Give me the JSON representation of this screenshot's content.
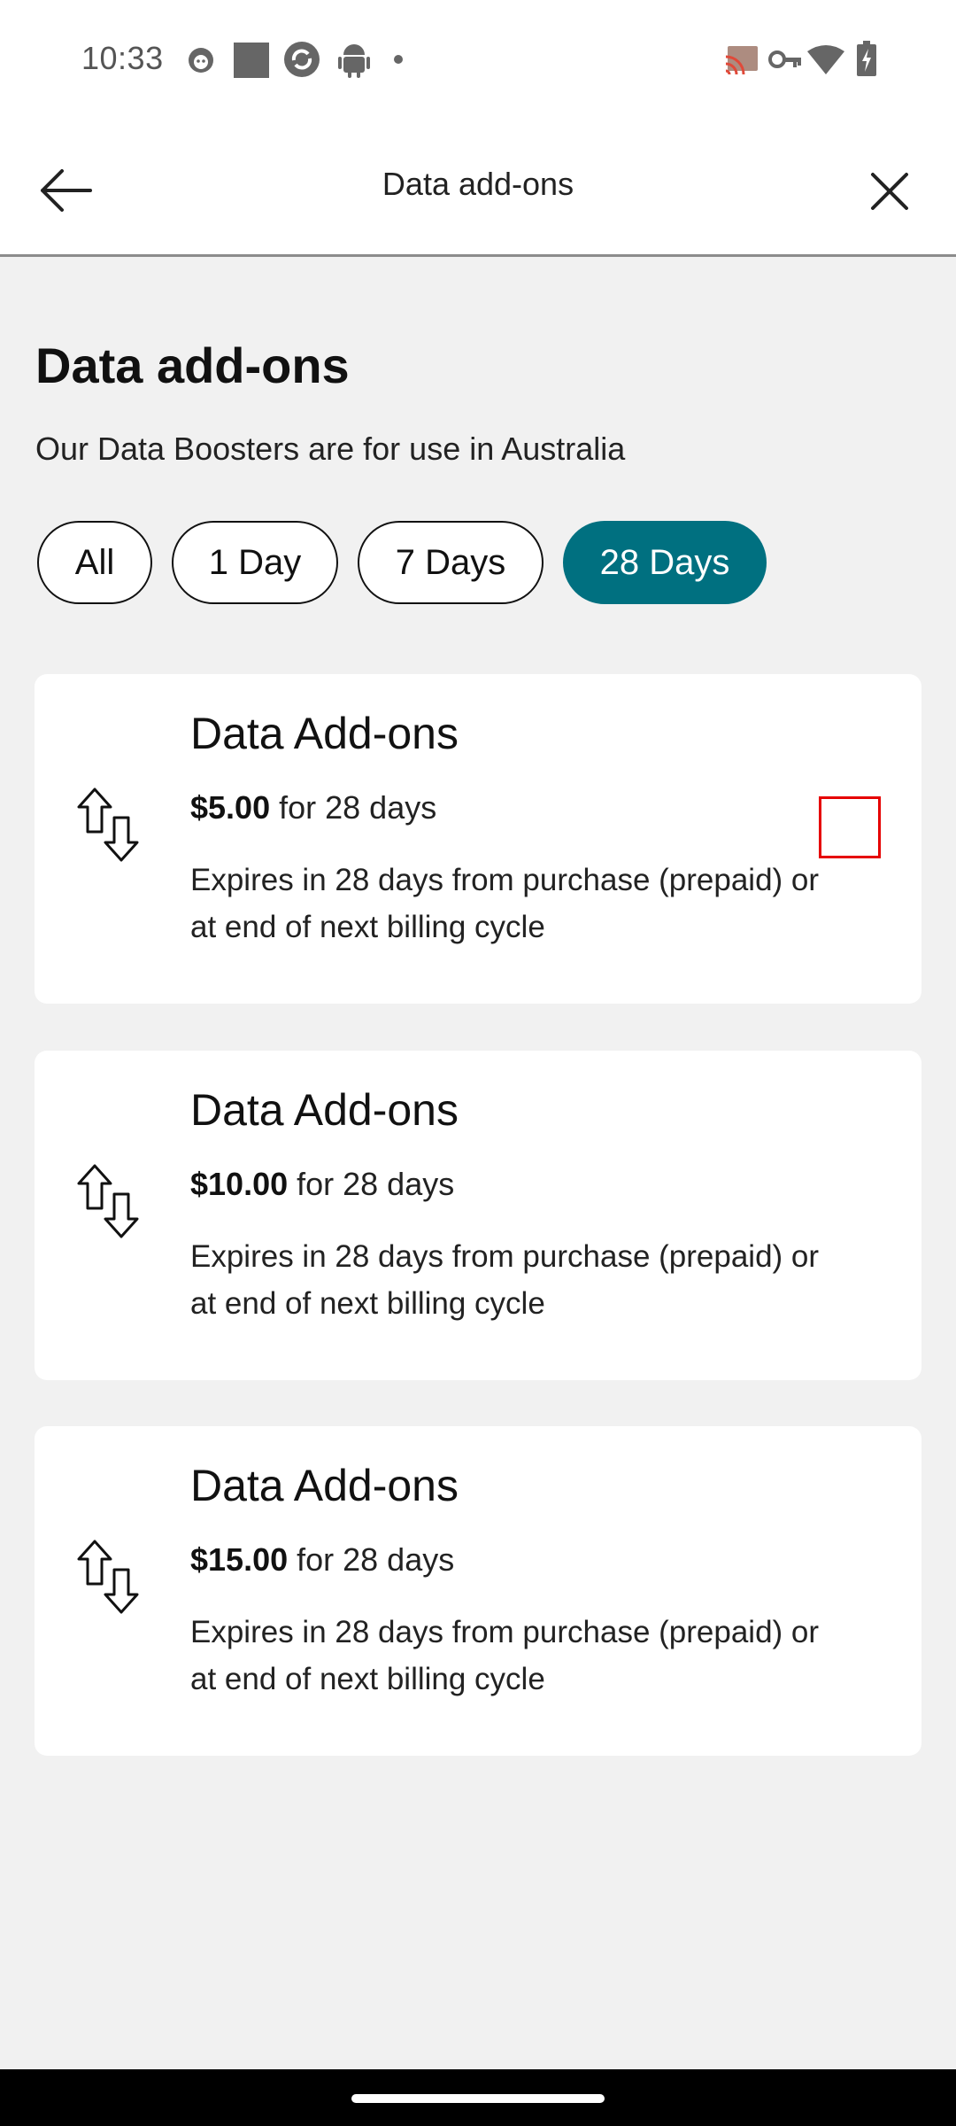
{
  "status_bar": {
    "time": "10:33",
    "icons": [
      "cat-notification-icon",
      "square-notification-icon",
      "sync-notification-icon",
      "android-notification-icon",
      "dot-icon",
      "cast-icon",
      "vpn-key-icon",
      "wifi-icon",
      "battery-charging-icon"
    ]
  },
  "app_bar": {
    "title": "Data add-ons",
    "back_icon": "arrow-left-icon",
    "close_icon": "close-icon"
  },
  "page": {
    "heading": "Data add-ons",
    "subtitle": "Our Data Boosters are for use in Australia"
  },
  "filters": {
    "chips": [
      "All",
      "1 Day",
      "7 Days",
      "28 Days"
    ],
    "selected": "28 Days"
  },
  "cards": [
    {
      "title": "Data Add-ons",
      "price": "$5.00",
      "period": "for 28 days",
      "description": "Expires in 28 days from purchase (prepaid) or at end of next billing cycle",
      "icon": "data-transfer-icon",
      "has_checkbox": true
    },
    {
      "title": "Data Add-ons",
      "price": "$10.00",
      "period": "for 28 days",
      "description": "Expires in 28 days from purchase (prepaid) or at end of next billing cycle",
      "icon": "data-transfer-icon",
      "has_checkbox": false
    },
    {
      "title": "Data Add-ons",
      "price": "$15.00",
      "period": "for 28 days",
      "description": "Expires in 28 days from purchase (prepaid) or at end of next billing cycle",
      "icon": "data-transfer-icon",
      "has_checkbox": false
    }
  ],
  "colors": {
    "accent": "#007080",
    "checkbox_border": "#e60000",
    "background": "#f1f1f1"
  }
}
